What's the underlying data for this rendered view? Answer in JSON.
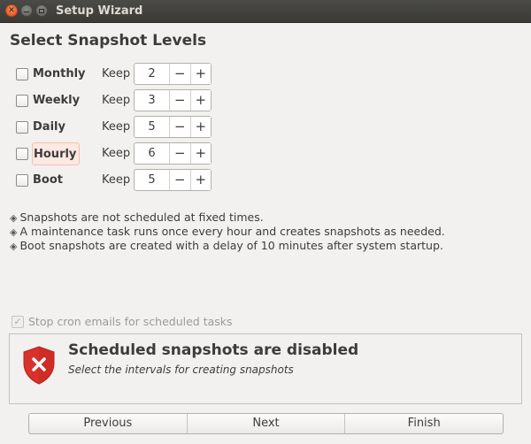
{
  "window": {
    "title": "Setup Wizard"
  },
  "page": {
    "heading": "Select Snapshot Levels"
  },
  "levels": [
    {
      "label": "Monthly",
      "keep_label": "Keep",
      "value": "2",
      "checked": false,
      "highlighted": false
    },
    {
      "label": "Weekly",
      "keep_label": "Keep",
      "value": "3",
      "checked": false,
      "highlighted": false
    },
    {
      "label": "Daily",
      "keep_label": "Keep",
      "value": "5",
      "checked": false,
      "highlighted": false
    },
    {
      "label": "Hourly",
      "keep_label": "Keep",
      "value": "6",
      "checked": false,
      "highlighted": true
    },
    {
      "label": "Boot",
      "keep_label": "Keep",
      "value": "5",
      "checked": false,
      "highlighted": false
    }
  ],
  "spinner": {
    "minus": "−",
    "plus": "+"
  },
  "info_lines": [
    "Snapshots are not scheduled at fixed times.",
    "A maintenance task runs once every hour and creates snapshots as needed.",
    "Boot snapshots are created with a delay of 10 minutes after system startup."
  ],
  "bullet_glyph": "◈",
  "cron_option": {
    "label": "Stop cron emails for scheduled tasks",
    "checked": true,
    "enabled": false
  },
  "status": {
    "title": "Scheduled snapshots are disabled",
    "subtitle": "Select the intervals for creating snapshots",
    "icon": "error-shield-icon",
    "color": "#d9312b"
  },
  "nav": {
    "previous": "Previous",
    "next": "Next",
    "finish": "Finish"
  }
}
